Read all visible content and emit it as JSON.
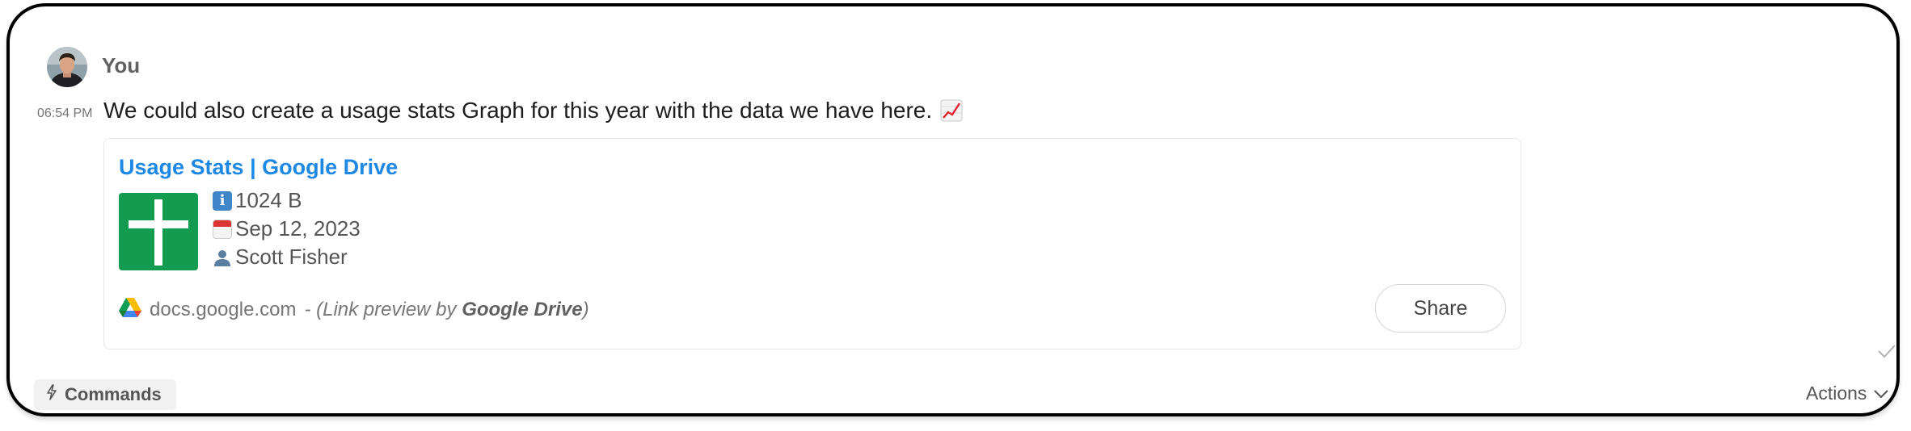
{
  "message": {
    "sender": "You",
    "time": "06:54 PM",
    "text": "We could also create a usage stats Graph for this year with the data we have here.",
    "emoji_icon": "chart-increasing-icon"
  },
  "preview": {
    "title": "Usage Stats | Google Drive",
    "file_size": "1024 B",
    "date": "Sep 12, 2023",
    "owner": "Scott Fisher",
    "domain": "docs.google.com",
    "preview_prefix": "- (Link preview by ",
    "preview_source": "Google Drive",
    "preview_suffix": ")",
    "share_label": "Share",
    "icon_color": "#139c50",
    "title_color": "#1e88e5"
  },
  "toolbar": {
    "commands_label": "Commands",
    "actions_label": "Actions"
  }
}
